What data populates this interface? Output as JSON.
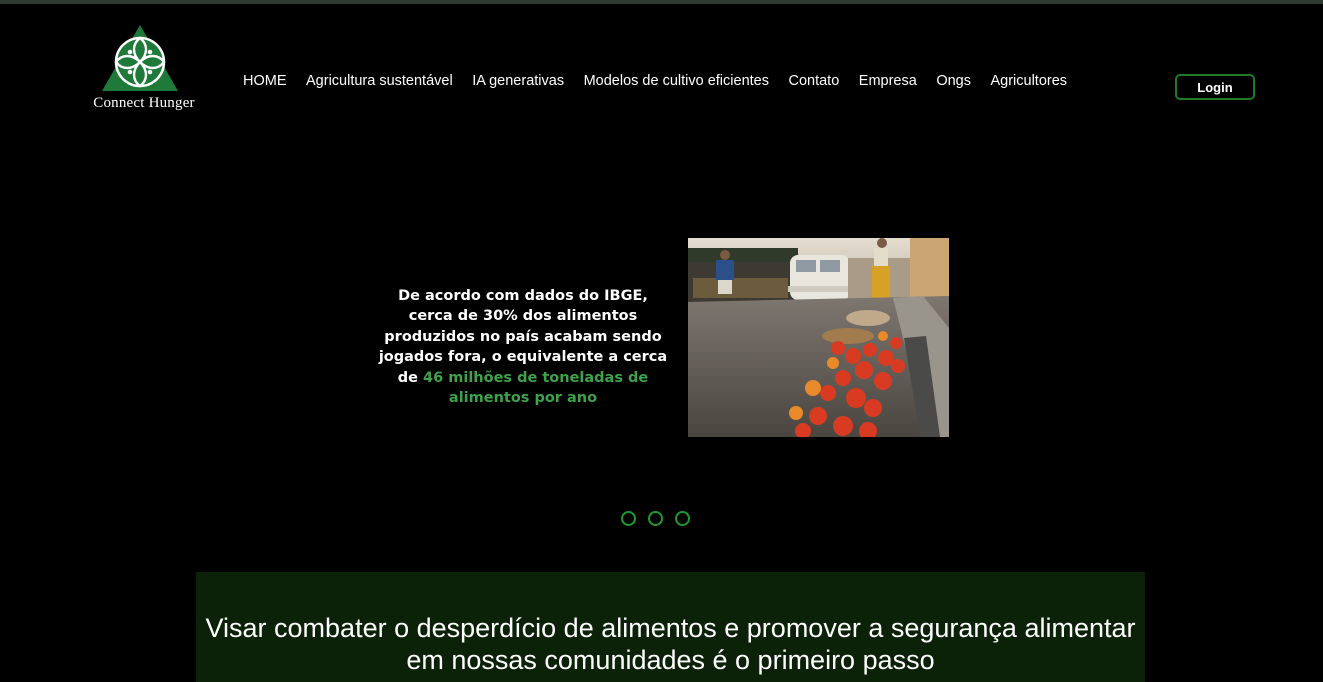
{
  "brand": {
    "name": "Connect Hunger",
    "logo_icon": "flower-of-life-on-triangle",
    "colors": {
      "accent": "#1e7a28",
      "highlight": "#3ea24b",
      "panel": "#0b2209",
      "background": "#000000"
    }
  },
  "nav": {
    "items": [
      {
        "label": "HOME"
      },
      {
        "label": "Agricultura sustentável"
      },
      {
        "label": "IA generativas"
      },
      {
        "label": "Modelos de cultivo eficientes"
      },
      {
        "label": "Contato"
      },
      {
        "label": "Empresa"
      },
      {
        "label": "Ongs"
      },
      {
        "label": "Agricultores"
      }
    ],
    "login_label": "Login"
  },
  "carousel": {
    "slide_text_plain": "De acordo com dados do IBGE, cerca de 30% dos alimentos produzidos no país acabam sendo jogados fora, o equivalente a cerca de",
    "slide_text_highlight": "46 milhões de toneladas de alimentos por ano",
    "image_description_icon": "wasted-tomatoes-street-photo",
    "dots_count": 3
  },
  "mission": {
    "text": "Visar combater o desperdício de alimentos e promover a segurança alimentar em nossas comunidades é o primeiro passo"
  }
}
